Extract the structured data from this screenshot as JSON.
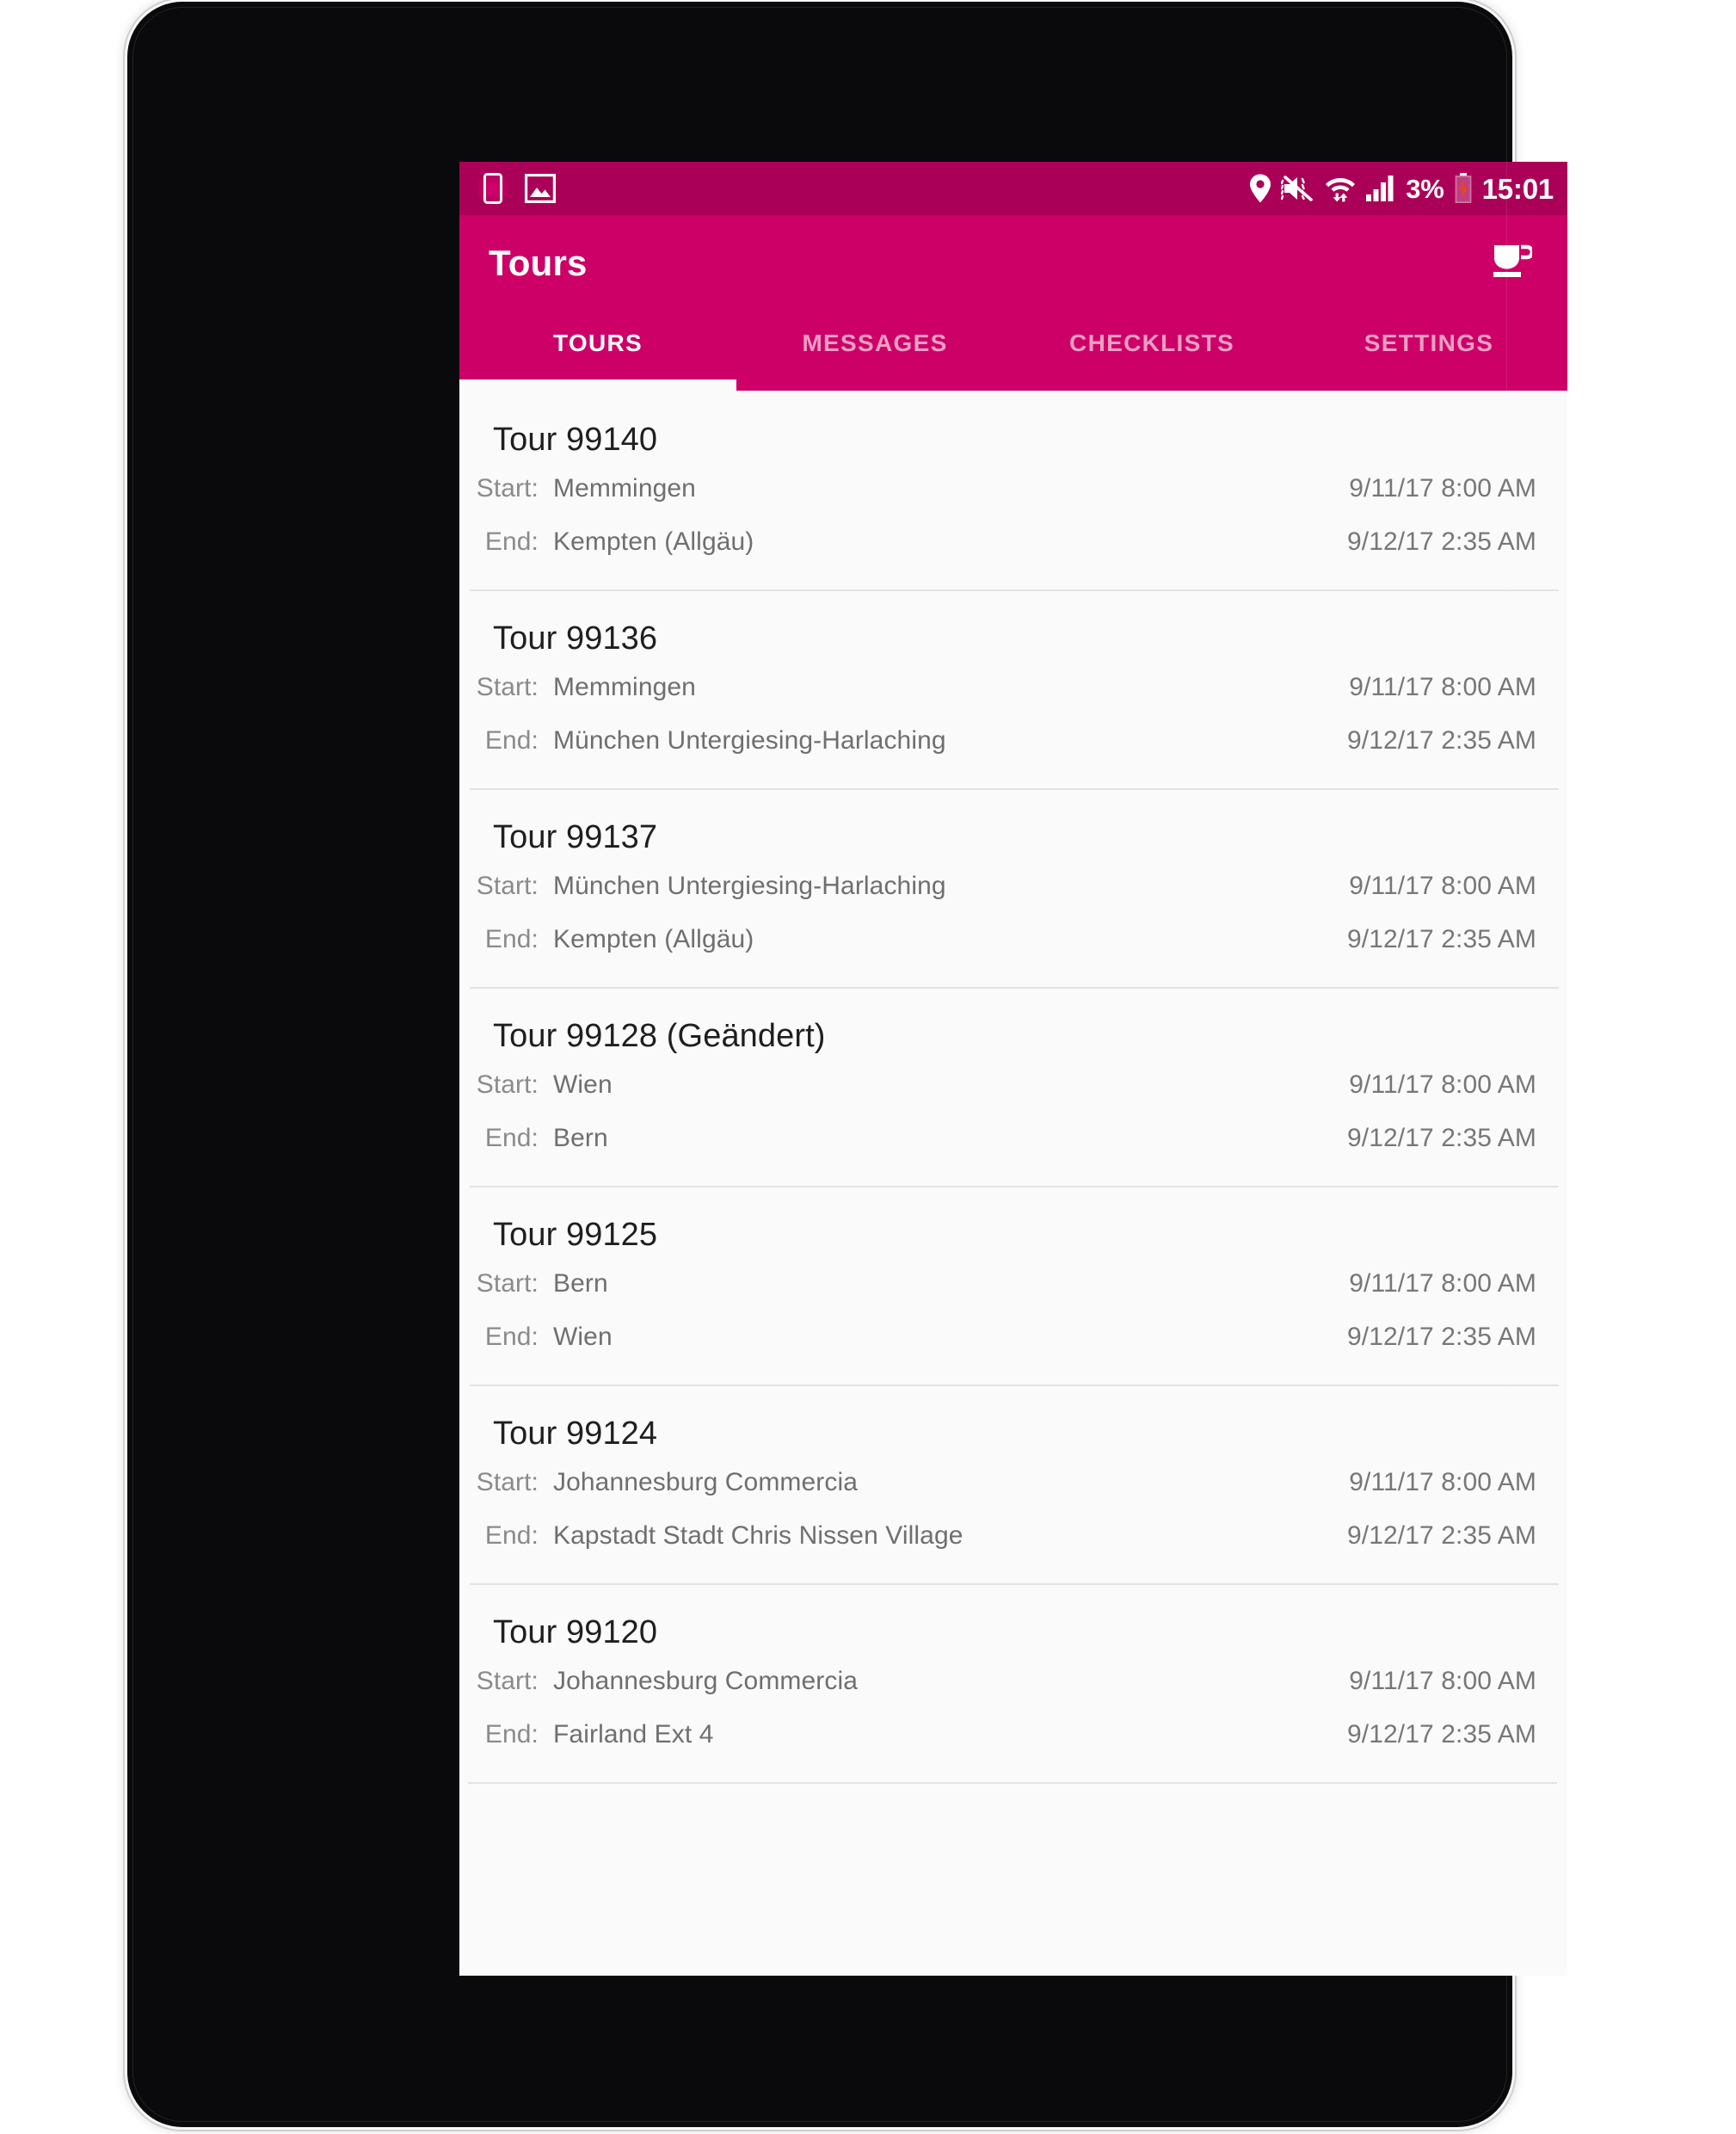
{
  "status_bar": {
    "left_icons": [
      {
        "name": "device-notification-icon",
        "glyph": "phone"
      },
      {
        "name": "image-notification-icon",
        "glyph": "image"
      }
    ],
    "right_icons": [
      {
        "name": "location-icon",
        "glyph": "pin"
      },
      {
        "name": "sound-muted-icon",
        "glyph": "mute"
      },
      {
        "name": "wifi-icon",
        "glyph": "wifi"
      },
      {
        "name": "cellular-signal-icon",
        "glyph": "bars"
      }
    ],
    "battery_percent": "3%",
    "battery_icon": "battery-low-icon",
    "battery_color": "#e8471f",
    "clock": "15:01"
  },
  "app_bar": {
    "title": "Tours",
    "action_icon": "coffee-cup-icon",
    "background": "#cc0066",
    "status_background": "#ab0057"
  },
  "tabs": [
    {
      "label": "TOURS",
      "active": true
    },
    {
      "label": "MESSAGES",
      "active": false
    },
    {
      "label": "CHECKLISTS",
      "active": false
    },
    {
      "label": "SETTINGS",
      "active": false
    }
  ],
  "list": {
    "start_label": "Start:",
    "end_label": "End:",
    "tours": [
      {
        "title": "Tour 99140",
        "start_location": "Memmingen",
        "start_time": "9/11/17 8:00 AM",
        "end_location": "Kempten (Allgäu)",
        "end_time": "9/12/17 2:35 AM"
      },
      {
        "title": "Tour 99136",
        "start_location": "Memmingen",
        "start_time": "9/11/17 8:00 AM",
        "end_location": "München Untergiesing-Harlaching",
        "end_time": "9/12/17 2:35 AM"
      },
      {
        "title": "Tour 99137",
        "start_location": "München Untergiesing-Harlaching",
        "start_time": "9/11/17 8:00 AM",
        "end_location": "Kempten (Allgäu)",
        "end_time": "9/12/17 2:35 AM"
      },
      {
        "title": "Tour 99128 (Geändert)",
        "start_location": "Wien",
        "start_time": "9/11/17 8:00 AM",
        "end_location": "Bern",
        "end_time": "9/12/17 2:35 AM"
      },
      {
        "title": "Tour 99125",
        "start_location": "Bern",
        "start_time": "9/11/17 8:00 AM",
        "end_location": "Wien",
        "end_time": "9/12/17 2:35 AM"
      },
      {
        "title": "Tour 99124",
        "start_location": "Johannesburg Commercia",
        "start_time": "9/11/17 8:00 AM",
        "end_location": "Kapstadt Stadt Chris Nissen Village",
        "end_time": "9/12/17 2:35 AM"
      },
      {
        "title": "Tour 99120",
        "start_location": "Johannesburg Commercia",
        "start_time": "9/11/17 8:00 AM",
        "end_location": "Fairland Ext 4",
        "end_time": "9/12/17 2:35 AM"
      }
    ]
  }
}
